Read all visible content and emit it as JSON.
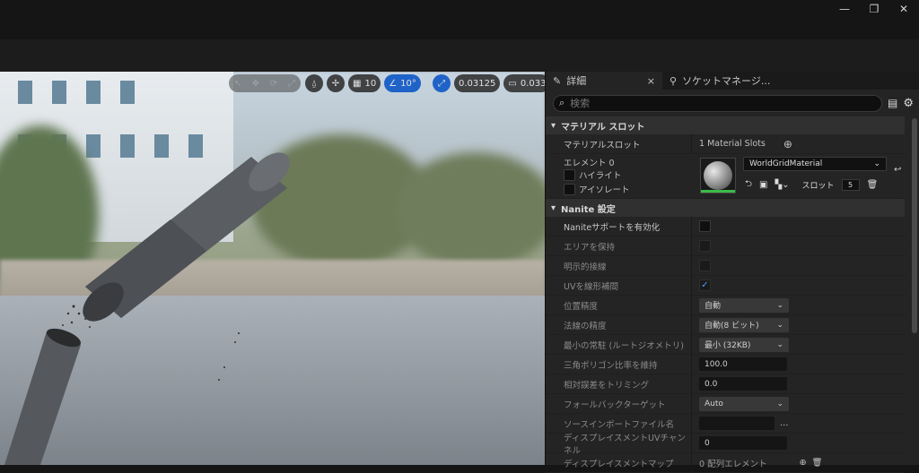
{
  "window_controls": {
    "minimize": "—",
    "restore": "❐",
    "close": "✕"
  },
  "viewport_toolbar": {
    "grid_snap": "10",
    "angle_snap": "10°",
    "scale_snap": "0.03125",
    "camera_speed": "0.033"
  },
  "tabs": [
    {
      "label": "詳細",
      "icon": "pencil-icon",
      "close": "×"
    },
    {
      "label": "ソケットマネージ...",
      "icon": "socket-icon"
    }
  ],
  "search": {
    "placeholder": "検索"
  },
  "material_slots": {
    "section_title": "マテリアル スロット",
    "slots_label": "マテリアルスロット",
    "slots_value": "1 Material Slots",
    "element_label": "エレメント 0",
    "highlight_label": "ハイライト",
    "isolate_label": "アイソレート",
    "material_name": "WorldGridMaterial",
    "slot_label": "スロット",
    "slot_value": "5"
  },
  "nanite": {
    "section_title": "Nanite 設定",
    "rows": [
      {
        "label": "Naniteサポートを有効化",
        "type": "check",
        "checked": false
      },
      {
        "label": "エリアを保持",
        "type": "check",
        "checked": false
      },
      {
        "label": "明示的接線",
        "type": "check",
        "checked": false
      },
      {
        "label": "UVを線形補間",
        "type": "check",
        "checked": true
      },
      {
        "label": "位置精度",
        "type": "drop",
        "value": "自動"
      },
      {
        "label": "法線の精度",
        "type": "drop",
        "value": "自動(8 ビット)"
      },
      {
        "label": "最小の常駐 (ルートジオメトリ)",
        "type": "drop",
        "value": "最小 (32KB)"
      },
      {
        "label": "三角ポリゴン比率を維持",
        "type": "num",
        "value": "100.0"
      },
      {
        "label": "相対誤差をトリミング",
        "type": "num",
        "value": "0.0"
      },
      {
        "label": "フォールバックターゲット",
        "type": "drop",
        "value": "Auto"
      },
      {
        "label": "ソースインポートファイル名",
        "type": "file",
        "value": ""
      },
      {
        "label": "ディスプレイスメントUVチャンネル",
        "type": "num",
        "value": "0"
      },
      {
        "label": "ディスプレイスメントマップ",
        "type": "array",
        "value": "0 配列エレメント"
      }
    ]
  }
}
